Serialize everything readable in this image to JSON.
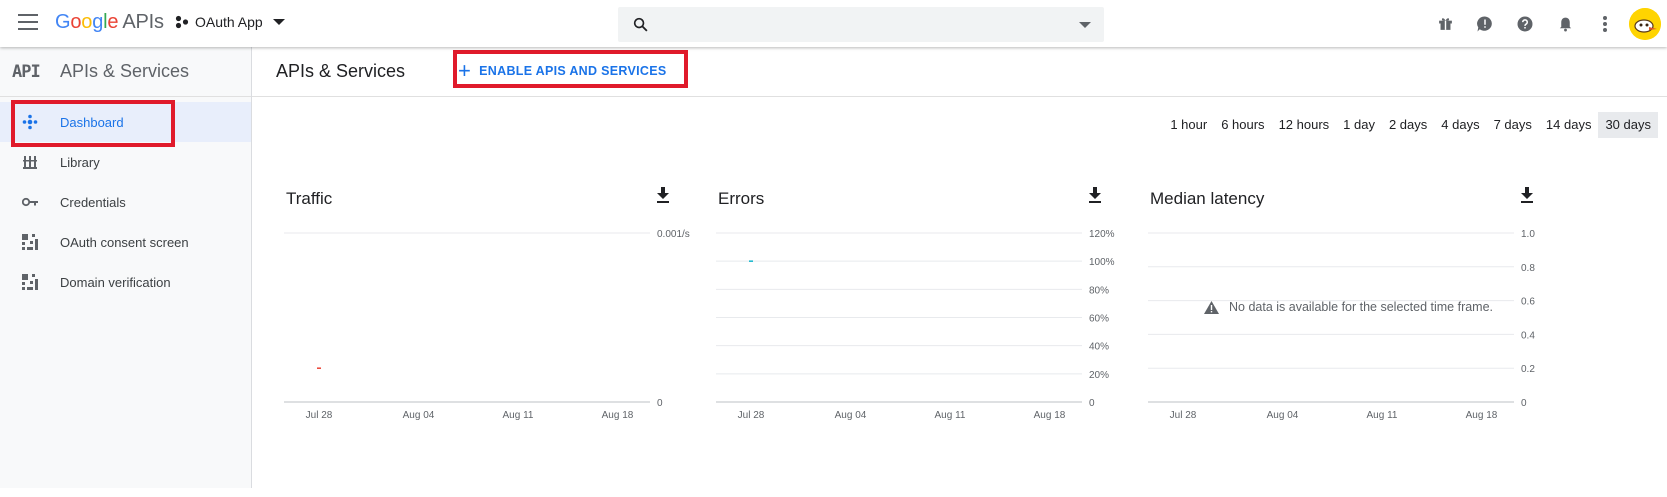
{
  "topbar": {
    "logo_letters": [
      "G",
      "o",
      "o",
      "g",
      "l",
      "e"
    ],
    "logo_suffix": "APIs",
    "project_name": "OAuth App",
    "search_placeholder": "",
    "icons": [
      "gift-icon",
      "feedback-icon",
      "help-icon",
      "notifications-icon",
      "more-vert-icon",
      "avatar"
    ]
  },
  "sidebar": {
    "badge": "API",
    "title": "APIs & Services",
    "items": [
      {
        "label": "Dashboard",
        "icon": "dashboard-icon",
        "active": true
      },
      {
        "label": "Library",
        "icon": "library-icon",
        "active": false
      },
      {
        "label": "Credentials",
        "icon": "key-icon",
        "active": false
      },
      {
        "label": "OAuth consent screen",
        "icon": "consent-icon",
        "active": false
      },
      {
        "label": "Domain verification",
        "icon": "verification-icon",
        "active": false
      }
    ]
  },
  "main": {
    "title": "APIs & Services",
    "enable_button": "ENABLE APIS AND SERVICES",
    "time_ranges": [
      "1 hour",
      "6 hours",
      "12 hours",
      "1 day",
      "2 days",
      "4 days",
      "7 days",
      "14 days",
      "30 days"
    ],
    "selected_range": "30 days"
  },
  "colors": {
    "accent": "#1a73e8",
    "highlight_box": "#e01a2b",
    "traffic_series": "#ea4335",
    "errors_series": "#12b5cb"
  },
  "chart_data": [
    {
      "type": "line",
      "title": "Traffic",
      "x_ticks": [
        "Jul 28",
        "Aug 04",
        "Aug 11",
        "Aug 18"
      ],
      "y_ticks": [
        "0.001/s",
        "0"
      ],
      "ylim": [
        0,
        0.001
      ],
      "series": [
        {
          "points": [
            {
              "x": "Jul 28",
              "y": 0.0002
            }
          ]
        }
      ]
    },
    {
      "type": "line",
      "title": "Errors",
      "x_ticks": [
        "Jul 28",
        "Aug 04",
        "Aug 11",
        "Aug 18"
      ],
      "y_ticks": [
        "120%",
        "100%",
        "80%",
        "60%",
        "40%",
        "20%",
        "0"
      ],
      "ylim": [
        0,
        120
      ],
      "series": [
        {
          "points": [
            {
              "x": "Jul 28",
              "y": 100
            }
          ]
        }
      ]
    },
    {
      "type": "line",
      "title": "Median latency",
      "x_ticks": [
        "Jul 28",
        "Aug 04",
        "Aug 11",
        "Aug 18"
      ],
      "y_ticks": [
        "1.0",
        "0.8",
        "0.6",
        "0.4",
        "0.2",
        "0"
      ],
      "ylim": [
        0,
        1
      ],
      "no_data_message": "No data is available for the selected time frame.",
      "series": []
    }
  ]
}
